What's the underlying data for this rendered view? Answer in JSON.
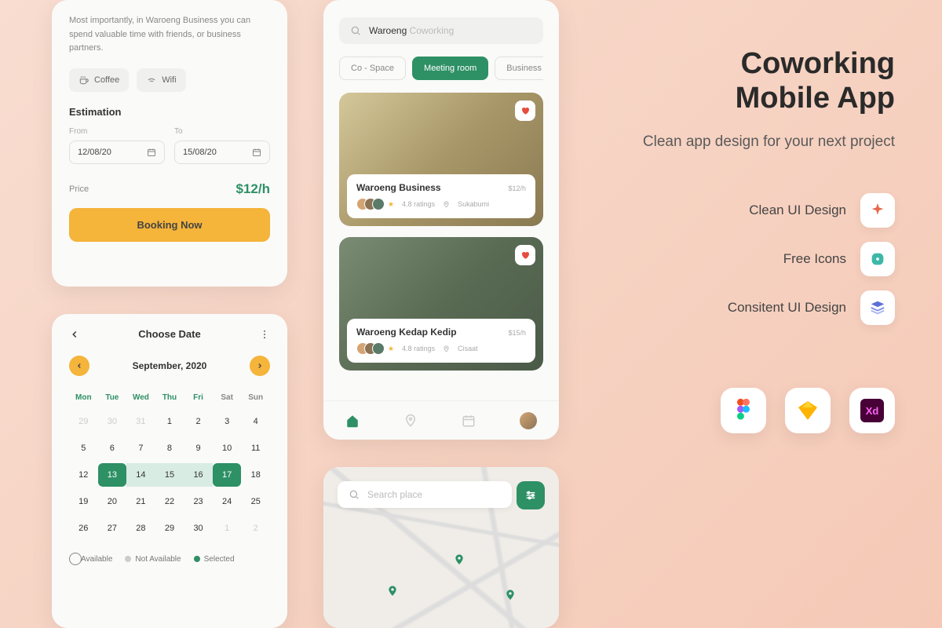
{
  "booking": {
    "description": "Most importantly, in Waroeng Business you can spend valuable time with friends, or business partners.",
    "tags": {
      "coffee": "Coffee",
      "wifi": "Wifi"
    },
    "estimation_title": "Estimation",
    "from_label": "From",
    "from_value": "12/08/20",
    "to_label": "To",
    "to_value": "15/08/20",
    "price_label": "Price",
    "price_value": "$12/h",
    "cta": "Booking Now"
  },
  "calendar": {
    "title": "Choose Date",
    "month": "September, 2020",
    "days": [
      "Mon",
      "Tue",
      "Wed",
      "Thu",
      "Fri",
      "Sat",
      "Sun"
    ],
    "legend": {
      "available": "Available",
      "not_available": "Not Available",
      "selected": "Selected"
    }
  },
  "home": {
    "search_typed": "Waroeng",
    "search_hint": " Coworking",
    "chips": [
      "Co - Space",
      "Meeting room",
      "Business Ro"
    ],
    "card1": {
      "name": "Waroeng Business",
      "price": "$12",
      "unit": "/h",
      "rating": "4.8 ratings",
      "location": "Sukabumi"
    },
    "card2": {
      "name": "Waroeng Kedap Kedip",
      "price": "$15",
      "unit": "/h",
      "rating": "4.8 ratings",
      "location": "Cisaat"
    }
  },
  "map": {
    "search_placeholder": "Search place"
  },
  "marketing": {
    "title_l1": "Coworking",
    "title_l2": "Mobile App",
    "subtitle": "Clean app design for your next project",
    "feat1": "Clean UI Design",
    "feat2": "Free Icons",
    "feat3": "Consitent UI Design"
  }
}
